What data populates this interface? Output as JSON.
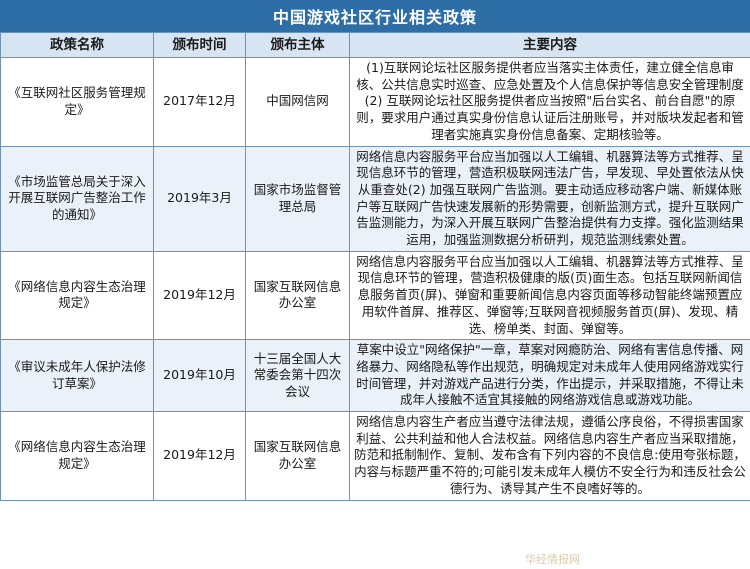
{
  "title": "中国游戏社区行业相关政策",
  "headers": [
    "政策名称",
    "颁布时间",
    "颁布主体",
    "主要内容"
  ],
  "rows": [
    {
      "name": "《互联网社区服务管理规定》",
      "date": "2017年12月",
      "issuer": "中国网信网",
      "content": "(1)互联网论坛社区服务提供者应当落实主体责任，建立健全信息审核、公共信息实时巡查、应急处置及个人信息保护等信息安全管理制度(2) 互联网论坛社区服务提供者应当按照\"后台实名、前台自愿\"的原则，要求用户通过真实身份信息认证后注册账号，并对版块发起者和管理者实施真实身份信息备案、定期核验等。"
    },
    {
      "name": "《市场监管总局关于深入开展互联网广告整治工作的通知》",
      "date": "2019年3月",
      "issuer": "国家市场监督管理总局",
      "content": "网络信息内容服务平台应当加强以人工编辑、机器算法等方式推荐、呈现信息环节的管理，营造积极联网违法广告，早发现、早处置依法从快从重查处(2) 加强互联网广告监测。要主动适应移动客户端、新媒体账户等互联网广告快速发展新的形势需要，创新监测方式，提升互联网广告监测能力，为深入开展互联网广告整治提供有力支撑。强化监测结果运用，加强监测数据分析研判，规范监测线索处置。"
    },
    {
      "name": "《网络信息内容生态治理规定》",
      "date": "2019年12月",
      "issuer": "国家互联网信息办公室",
      "content": "网络信息内容服务平台应当加强以人工编辑、机器算法等方式推荐、呈现信息环节的管理，营造积极健康的版(页)面生态。包括互联网新闻信息服务首页(屏)、弹窗和重要新闻信息内容页面等移动智能终端预置应用软件首屏、推荐区、弹窗等;互联网音视频服务首页(屏)、发现、精选、榜单类、封面、弹窗等。"
    },
    {
      "name": "《审议未成年人保护法修订草案》",
      "date": "2019年10月",
      "issuer": "十三届全国人大常委会第十四次会议",
      "content": "草案中设立\"网络保护\"一章，草案对网瘾防治、网络有害信息传播、网络暴力、网络隐私等作出规范，明确规定对未成年人使用网络游戏实行时间管理，并对游戏产品进行分类，作出提示，并采取措施，不得让未成年人接触不适宜其接触的网络游戏信息或游戏功能。"
    },
    {
      "name": "《网络信息内容生态治理规定》",
      "date": "2019年12月",
      "issuer": "国家互联网信息办公室",
      "content": "网络信息内容生产者应当遵守法律法规，遵循公序良俗，不得损害国家利益、公共利益和他人合法权益。网络信息内容生产者应当采取措施，防范和抵制制作、复制、发布含有下列内容的不良信息:使用夸张标题，内容与标题严重不符的;可能引发未成年人模仿不安全行为和违反社会公德行为、诱导其产生不良嗜好等的。"
    }
  ],
  "watermark": "华经情报网"
}
